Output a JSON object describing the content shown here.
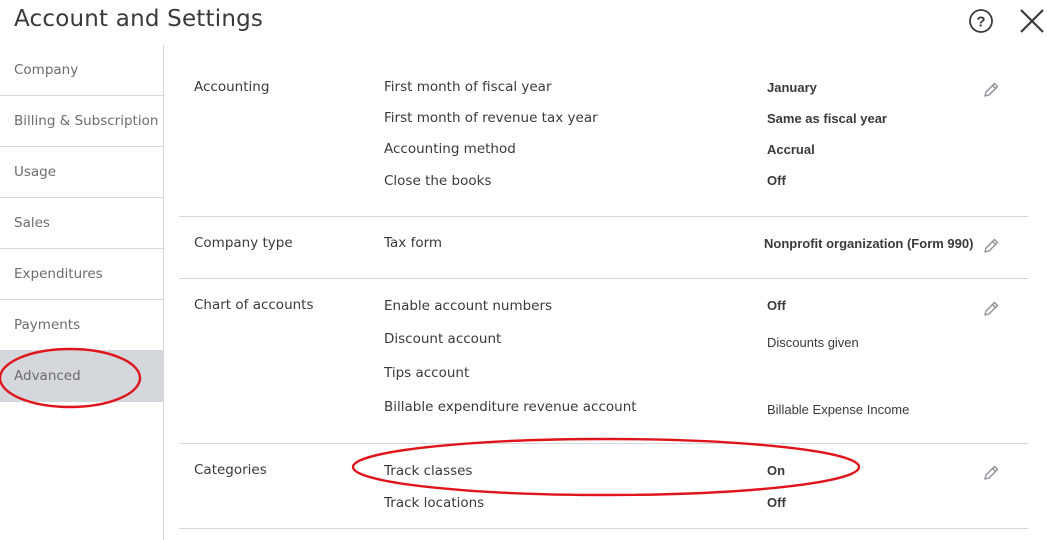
{
  "header": {
    "title": "Account and Settings"
  },
  "sidebar": {
    "items": [
      {
        "label": "Company"
      },
      {
        "label": "Billing & Subscription"
      },
      {
        "label": "Usage"
      },
      {
        "label": "Sales"
      },
      {
        "label": "Expenditures"
      },
      {
        "label": "Payments"
      },
      {
        "label": "Advanced",
        "active": true
      }
    ]
  },
  "sections": {
    "accounting": {
      "label": "Accounting",
      "rows": [
        {
          "label": "First month of fiscal year",
          "value": "January"
        },
        {
          "label": "First month of revenue tax year",
          "value": "Same as fiscal year"
        },
        {
          "label": "Accounting method",
          "value": "Accrual"
        },
        {
          "label": "Close the books",
          "value": "Off"
        }
      ]
    },
    "company_type": {
      "label": "Company type",
      "rows": [
        {
          "label": "Tax form",
          "value": "Nonprofit organization (Form 990)"
        }
      ]
    },
    "chart_of_accounts": {
      "label": "Chart of accounts",
      "rows": [
        {
          "label": "Enable account numbers",
          "value": "Off"
        },
        {
          "label": "Discount account",
          "value": "Discounts given"
        },
        {
          "label": "Tips account",
          "value": ""
        },
        {
          "label": "Billable expenditure revenue account",
          "value": "Billable Expense Income"
        }
      ]
    },
    "categories": {
      "label": "Categories",
      "rows": [
        {
          "label": "Track classes",
          "value": "On"
        },
        {
          "label": "Track locations",
          "value": "Off"
        }
      ]
    }
  },
  "colors": {
    "annotation": "#e0151b",
    "divider": "#d4d7dc",
    "active_bg": "#d4d7dc",
    "text": "#393a3d",
    "muted": "#6b6c72"
  }
}
